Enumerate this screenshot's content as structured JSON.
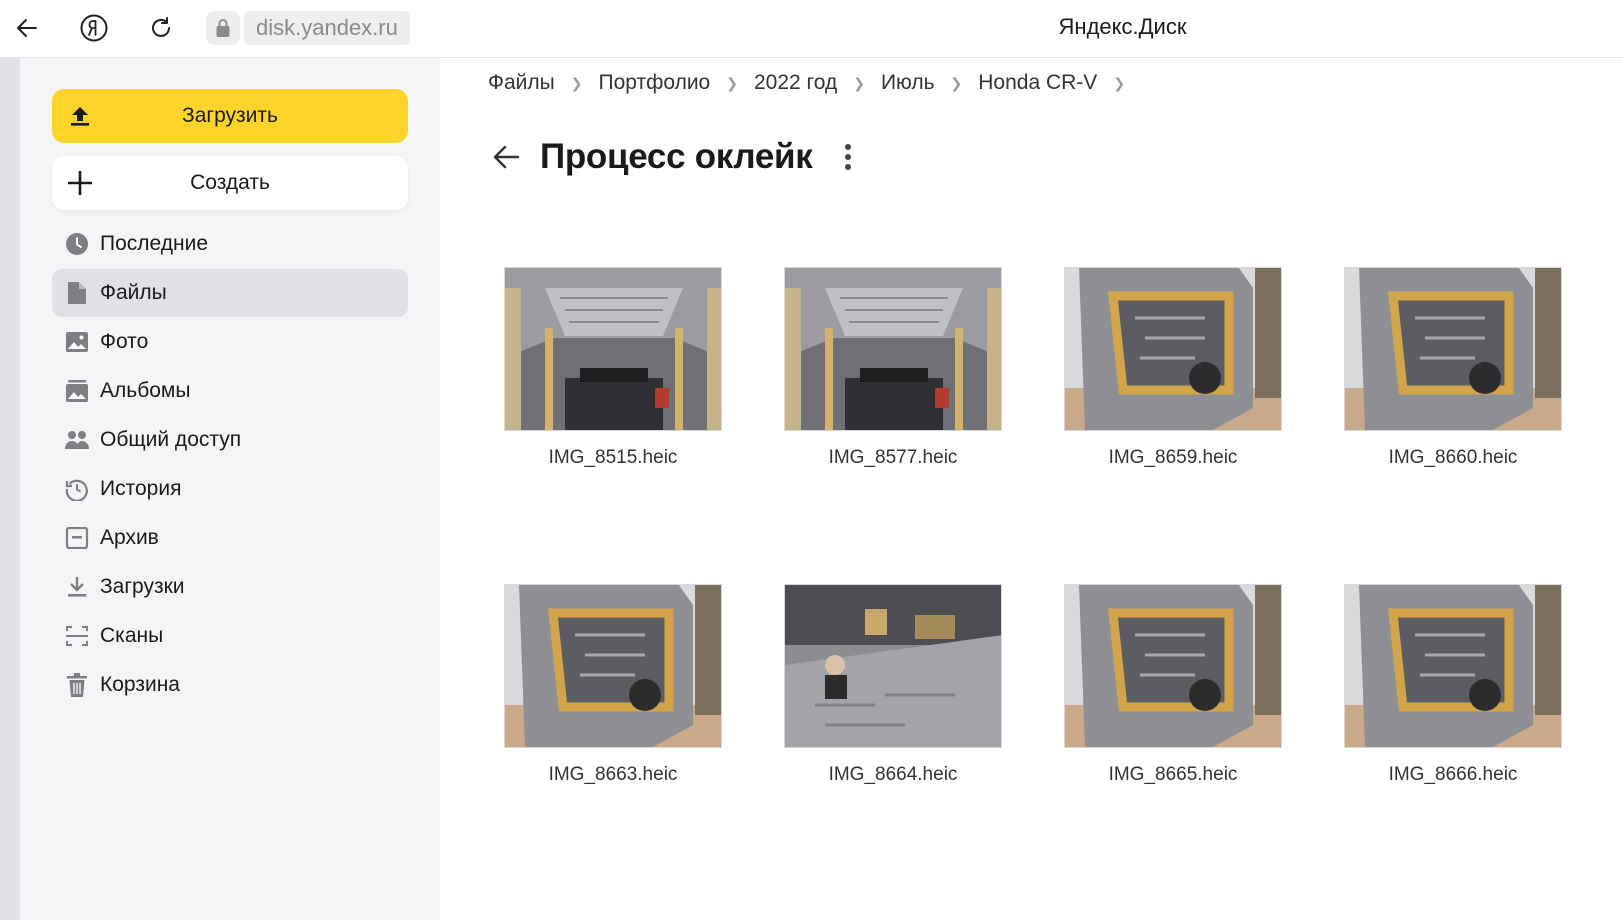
{
  "browser": {
    "url": "disk.yandex.ru",
    "page_title": "Яндекс.Диск",
    "icons": [
      "back-arrow-icon",
      "yandex-logo-icon",
      "reload-icon",
      "lock-icon"
    ]
  },
  "sidebar": {
    "upload_label": "Загрузить",
    "create_label": "Создать",
    "items": [
      {
        "label": "Последние",
        "icon": "clock-icon"
      },
      {
        "label": "Файлы",
        "icon": "file-icon",
        "active": true
      },
      {
        "label": "Фото",
        "icon": "photo-icon"
      },
      {
        "label": "Альбомы",
        "icon": "albums-icon"
      },
      {
        "label": "Общий доступ",
        "icon": "shared-icon"
      },
      {
        "label": "История",
        "icon": "history-icon"
      },
      {
        "label": "Архив",
        "icon": "archive-icon"
      },
      {
        "label": "Загрузки",
        "icon": "download-icon"
      },
      {
        "label": "Сканы",
        "icon": "scan-icon"
      },
      {
        "label": "Корзина",
        "icon": "trash-icon"
      }
    ]
  },
  "breadcrumbs": [
    "Файлы",
    "Портфолио",
    "2022 год",
    "Июль",
    "Honda CR-V"
  ],
  "folder": {
    "title": "Процесс оклейк",
    "files": [
      {
        "name": "IMG_8515.heic",
        "kind": "roof"
      },
      {
        "name": "IMG_8577.heic",
        "kind": "roof"
      },
      {
        "name": "IMG_8659.heic",
        "kind": "door"
      },
      {
        "name": "IMG_8660.heic",
        "kind": "door"
      },
      {
        "name": "IMG_8663.heic",
        "kind": "door"
      },
      {
        "name": "IMG_8664.heic",
        "kind": "floor"
      },
      {
        "name": "IMG_8665.heic",
        "kind": "door"
      },
      {
        "name": "IMG_8666.heic",
        "kind": "door"
      }
    ]
  },
  "colors": {
    "accent_yellow": "#fed42b",
    "sidebar_bg": "#f5f5f7",
    "active_item_bg": "#e0e1e6"
  }
}
